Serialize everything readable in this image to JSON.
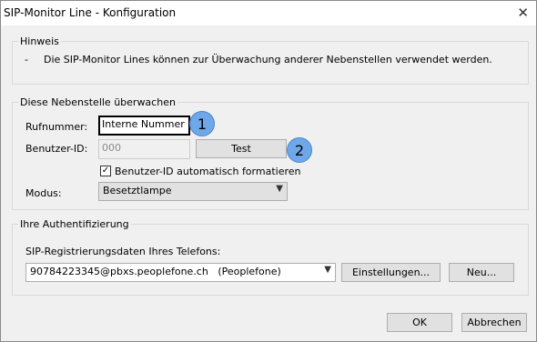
{
  "window": {
    "title": "SIP-Monitor Line - Konfiguration"
  },
  "hint": {
    "legend": "Hinweis",
    "bullet": "-",
    "text": "Die SIP-Monitor Lines können zur Überwachung anderer Nebenstellen verwendet werden."
  },
  "monitor": {
    "legend": "Diese Nebenstelle überwachen",
    "rufnummer_label": "Rufnummer:",
    "rufnummer_value": "Interne Nummer",
    "benutzer_label": "Benutzer-ID:",
    "benutzer_value": "000",
    "test_button": "Test",
    "auto_format_label": "Benutzer-ID automatisch formatieren",
    "auto_format_checked": "✓",
    "modus_label": "Modus:",
    "modus_value": "Besetztlampe"
  },
  "auth": {
    "legend": "Ihre Authentifizierung",
    "label": "SIP-Registrierungsdaten Ihres Telefons:",
    "selected": "90784223345@pbxs.peoplefone.ch   (Peoplefone)",
    "settings_button": "Einstellungen...",
    "new_button": "Neu..."
  },
  "badges": {
    "one": "1",
    "two": "2"
  },
  "footer": {
    "ok": "OK",
    "cancel": "Abbrechen"
  },
  "icons": {
    "close": "close-icon",
    "dropdown": "chevron-down-icon",
    "check": "checkmark-icon"
  },
  "colors": {
    "badge": "#6fa8e8",
    "window_bg": "#f0f0f0"
  }
}
